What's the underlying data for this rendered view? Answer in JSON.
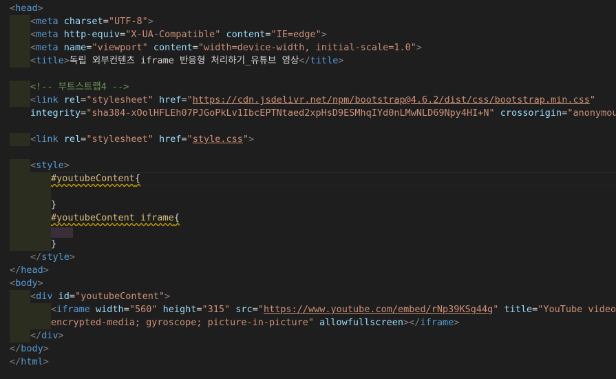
{
  "editor": {
    "l1": {
      "open": "<",
      "tag": "head",
      "close": ">"
    },
    "l2": {
      "open": "<",
      "tag": "meta",
      "a1": " charset",
      "eq1": "=",
      "v1": "\"UTF-8\"",
      "close": ">"
    },
    "l3": {
      "open": "<",
      "tag": "meta",
      "a1": " http-equiv",
      "eq1": "=",
      "v1": "\"X-UA-Compatible\"",
      "a2": " content",
      "eq2": "=",
      "v2": "\"IE=edge\"",
      "close": ">"
    },
    "l4": {
      "open": "<",
      "tag": "meta",
      "a1": " name",
      "eq1": "=",
      "v1": "\"viewport\"",
      "a2": " content",
      "eq2": "=",
      "v2": "\"width=device-width, initial-scale=1.0\"",
      "close": ">"
    },
    "l5": {
      "open": "<",
      "tag": "title",
      "close": ">",
      "text": "독립 외부컨텐츠 iframe 반응형 처리하기_유튜브 영상",
      "endopen": "</",
      "endtag": "title",
      "endclose": ">"
    },
    "l7": {
      "comment": "<!-- 부트스트랩4 -->"
    },
    "l8": {
      "open": "<",
      "tag": "link",
      "a1": " rel",
      "eq1": "=",
      "v1": "\"stylesheet\"",
      "a2": " href",
      "eq2": "=",
      "q1": "\"",
      "url": "https://cdn.jsdelivr.net/npm/bootstrap@4.6.2/dist/css/bootstrap.min.css",
      "q2": "\""
    },
    "l9": {
      "a1": "integrity",
      "eq1": "=",
      "v1": "\"sha384-xOolHFLEh07PJGoPkLv1IbcEPTNtaed2xpHsD9ESMhqIYd0nLMwNLD69Npy4HI+N\"",
      "a2": " crossorigin",
      "eq2": "=",
      "v2": "\"anonymous\"",
      "close": ">"
    },
    "l11": {
      "open": "<",
      "tag": "link",
      "a1": " rel",
      "eq1": "=",
      "v1": "\"stylesheet\"",
      "a2": " href",
      "eq2": "=",
      "q1": "\"",
      "url": "style.css",
      "q2": "\"",
      "close": ">"
    },
    "l13": {
      "open": "<",
      "tag": "style",
      "close": ">"
    },
    "l14": {
      "sel": "#youtubeContent",
      "brace": "{"
    },
    "l16": {
      "brace": "}"
    },
    "l17": {
      "sel": "#youtubeContent iframe",
      "brace": "{"
    },
    "l19": {
      "brace": "}"
    },
    "l20": {
      "open": "</",
      "tag": "style",
      "close": ">"
    },
    "l21": {
      "open": "</",
      "tag": "head",
      "close": ">"
    },
    "l22": {
      "open": "<",
      "tag": "body",
      "close": ">"
    },
    "l23": {
      "open": "<",
      "tag": "div",
      "a1": " id",
      "eq1": "=",
      "v1": "\"youtubeContent\"",
      "close": ">"
    },
    "l24": {
      "open": "<",
      "tag": "iframe",
      "a1": " width",
      "eq1": "=",
      "v1": "\"560\"",
      "a2": " height",
      "eq2": "=",
      "v2": "\"315\"",
      "a3": " src",
      "eq3": "=",
      "q1": "\"",
      "url": "https://www.youtube.com/embed/rNp39KSg44g",
      "q2": "\"",
      "a4": " title",
      "eq4": "=",
      "v4": "\"YouTube video playe"
    },
    "l25": {
      "v1": "encrypted-media; gyroscope; picture-in-picture\"",
      "a1": " allowfullscreen",
      "close": ">",
      "endopen": "</",
      "endtag": "iframe",
      "endclose": ">"
    },
    "l26": {
      "open": "</",
      "tag": "div",
      "close": ">"
    },
    "l27": {
      "open": "</",
      "tag": "body",
      "close": ">"
    },
    "l28": {
      "open": "</",
      "tag": "html",
      "close": ">"
    }
  }
}
